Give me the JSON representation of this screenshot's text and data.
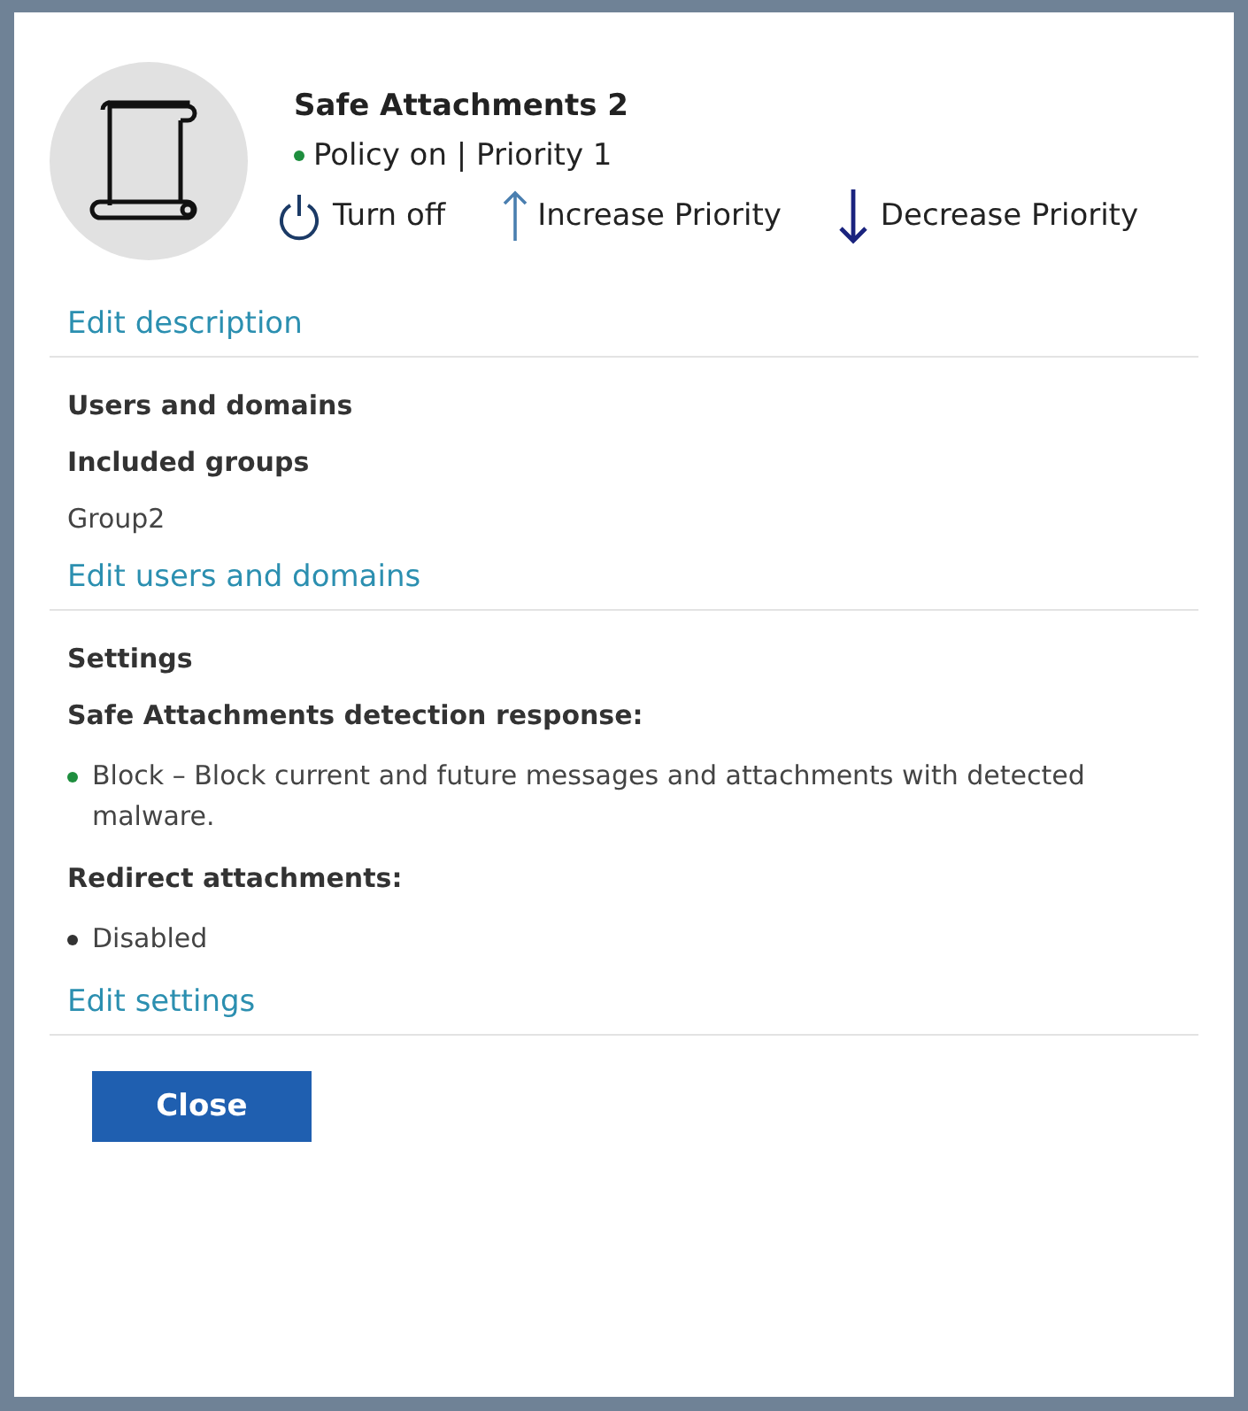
{
  "header": {
    "title": "Safe Attachments 2",
    "status": {
      "text": "Policy on | Priority 1",
      "color": "#1e8e3e"
    },
    "actions": [
      {
        "label": "Turn off",
        "kind": "power"
      },
      {
        "label": "Increase Priority",
        "kind": "up"
      },
      {
        "label": "Decrease Priority",
        "kind": "down"
      }
    ]
  },
  "sections": [
    {
      "link": "Edit description"
    },
    {
      "items": [
        {
          "kind": "heading",
          "text": "Users and domains"
        },
        {
          "kind": "subheading",
          "text": "Included groups"
        },
        {
          "kind": "text",
          "text": "Group2"
        }
      ],
      "link": "Edit users and domains"
    },
    {
      "items": [
        {
          "kind": "heading",
          "text": "Settings"
        },
        {
          "kind": "subheading",
          "text": "Safe Attachments detection response:"
        },
        {
          "kind": "bullet",
          "text": "Block – Block current and future messages and attachments with detected malware.",
          "color": "#1e8e3e"
        },
        {
          "kind": "subheading",
          "text": "Redirect attachments:"
        },
        {
          "kind": "bullet",
          "text": "Disabled",
          "color": "#333333"
        }
      ],
      "link": "Edit settings"
    }
  ],
  "buttons": [
    {
      "label": "Close"
    }
  ]
}
